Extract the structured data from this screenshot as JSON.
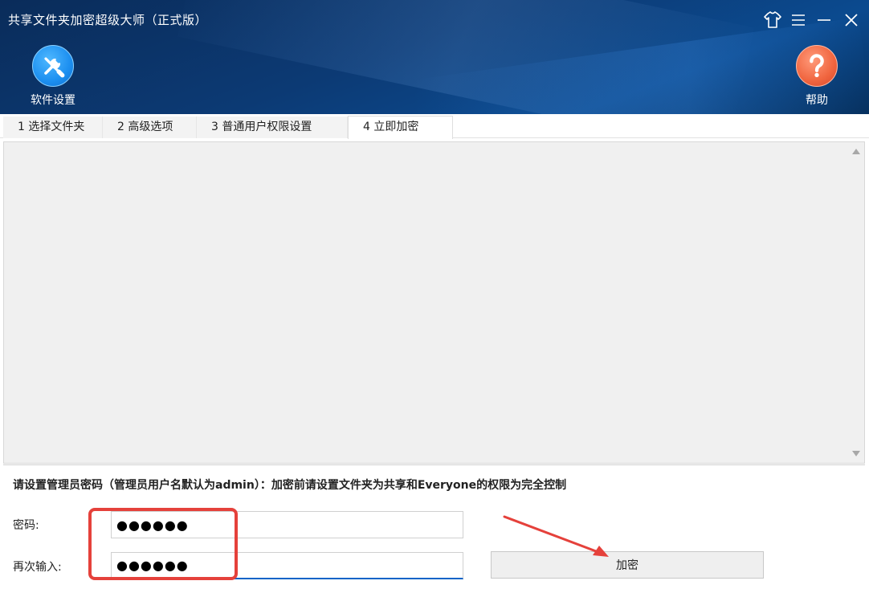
{
  "window": {
    "title": "共享文件夹加密超级大师（正式版）",
    "controls": [
      "skin-icon",
      "menu-icon",
      "minimize-icon",
      "close-icon"
    ]
  },
  "toolbar": {
    "settings_label": "软件设置",
    "settings_icon": "tools-icon",
    "help_label": "帮助",
    "help_icon": "question-icon"
  },
  "tabs": [
    {
      "label": "1 选择文件夹",
      "active": false
    },
    {
      "label": "2 高级选项",
      "active": false
    },
    {
      "label": "3 普通用户权限设置",
      "active": false
    },
    {
      "label": "4 立即加密",
      "active": true
    }
  ],
  "form": {
    "hint": "请设置管理员密码（管理员用户名默认为admin）：加密前请设置文件夹为共享和Everyone的权限为完全控制",
    "password_label": "密码:",
    "password_value": "●●●●●●",
    "confirm_label": "再次输入:",
    "confirm_value": "●●●●●●",
    "encrypt_button": "加密"
  },
  "colors": {
    "header_bg": "#0c3a74",
    "annotation": "#e5413b",
    "settings_icon_bg": "#1c8ff0",
    "help_icon_bg": "#f0653f"
  }
}
